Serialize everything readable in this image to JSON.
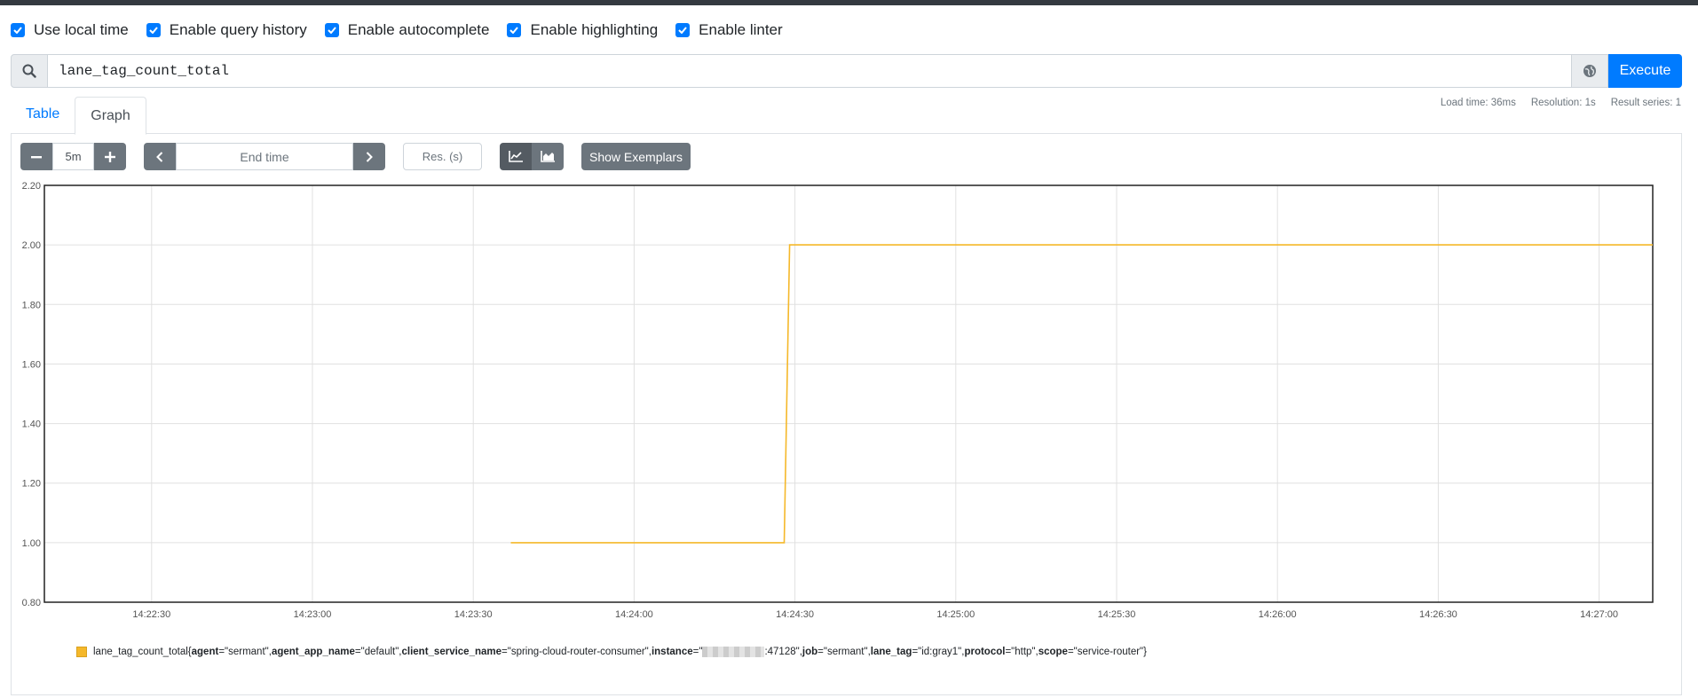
{
  "options": [
    {
      "label": "Use local time",
      "checked": true
    },
    {
      "label": "Enable query history",
      "checked": true
    },
    {
      "label": "Enable autocomplete",
      "checked": true
    },
    {
      "label": "Enable highlighting",
      "checked": true
    },
    {
      "label": "Enable linter",
      "checked": true
    }
  ],
  "query": {
    "expression": "lane_tag_count_total",
    "execute_label": "Execute"
  },
  "tabs": [
    {
      "label": "Table",
      "active": false
    },
    {
      "label": "Graph",
      "active": true
    }
  ],
  "stats": {
    "load_time": "Load time: 36ms",
    "resolution": "Resolution: 1s",
    "result_series": "Result series: 1"
  },
  "controls": {
    "range": "5m",
    "end_time_placeholder": "End time",
    "resolution_placeholder": "Res. (s)",
    "exemplars_label": "Show Exemplars"
  },
  "colors": {
    "series": "#f5b82a",
    "primary": "#007bff",
    "secondary": "#6c757d"
  },
  "chart_data": {
    "type": "line",
    "title": "",
    "xlabel": "",
    "ylabel": "",
    "ylim": [
      0.8,
      2.2
    ],
    "y_ticks": [
      "0.80",
      "1.00",
      "1.20",
      "1.40",
      "1.60",
      "1.80",
      "2.00",
      "2.20"
    ],
    "x_ticks": [
      "14:22:30",
      "14:23:00",
      "14:23:30",
      "14:24:00",
      "14:24:30",
      "14:25:00",
      "14:25:30",
      "14:26:00",
      "14:26:30",
      "14:27:00"
    ],
    "xlim": [
      "14:22:10",
      "14:27:10"
    ],
    "grid": true,
    "series": [
      {
        "name": "lane_tag_count_total",
        "points": [
          {
            "x": "14:23:37",
            "y": 1
          },
          {
            "x": "14:24:28",
            "y": 1
          },
          {
            "x": "14:24:29",
            "y": 2
          },
          {
            "x": "14:27:10",
            "y": 2
          }
        ]
      }
    ]
  },
  "legend": {
    "metric": "lane_tag_count_total{",
    "labels": [
      {
        "key": "agent",
        "value": "=\"sermant\", "
      },
      {
        "key": "agent_app_name",
        "value": "=\"default\", "
      },
      {
        "key": "client_service_name",
        "value": "=\"spring-cloud-router-consumer\", "
      },
      {
        "key": "instance",
        "value": "=\""
      },
      {
        "key": "",
        "value": ":47128\", "
      },
      {
        "key": "job",
        "value": "=\"sermant\", "
      },
      {
        "key": "lane_tag",
        "value": "=\"id:gray1\", "
      },
      {
        "key": "protocol",
        "value": "=\"http\", "
      },
      {
        "key": "scope",
        "value": "=\"service-router\"}"
      }
    ]
  }
}
